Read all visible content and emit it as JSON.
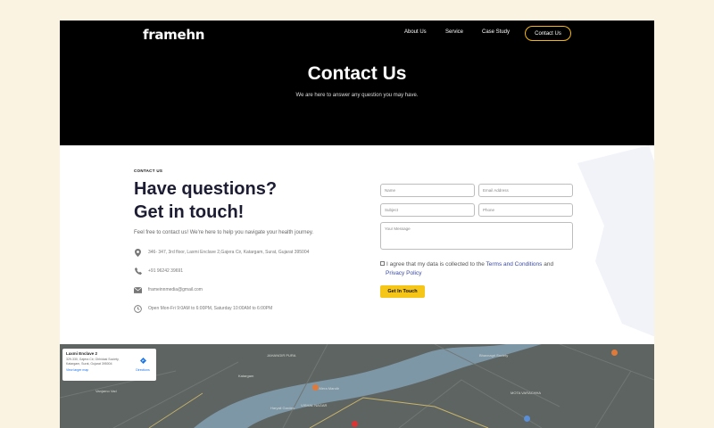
{
  "header": {
    "logo": "framehn",
    "nav": [
      "About Us",
      "Service",
      "Case Study"
    ],
    "cta": "Contact Us"
  },
  "hero": {
    "title": "Contact Us",
    "subtitle": "We are here to answer any question you may have."
  },
  "contact": {
    "eyebrow": "CONTACT US",
    "heading_line1": "Have questions?",
    "heading_line2": "Get in touch!",
    "intro": "Feel free to contact us! We're here to help you navigate your health journey.",
    "address": "346- 347, 3rd floor, Laxmi Enclave 2,Gajera Cir, Katargam, Surat, Gujarat 395004",
    "phone": "+91 96242 39691",
    "email": "frameinnmedia@gmail.com",
    "hours": "Open Mon-Fri 9:0AM to 6:00PM, Saturday 10:00AM to 6:00PM"
  },
  "form": {
    "name_placeholder": "Name",
    "email_placeholder": "Email Address",
    "subject_placeholder": "Subject",
    "phone_placeholder": "Phone",
    "message_placeholder": "Your Message",
    "consent_prefix": "I agree that my data is collected to the ",
    "terms_link": "Terms and Conditions",
    "consent_and": " and",
    "privacy_link": "Privacy Policy",
    "submit": "Get In Touch"
  },
  "map": {
    "card_title": "Laxmi Enclave 2",
    "card_address": "329-330, Gajera Cir, Ghhidasi Society, Katargam, Surat, Gujarat 395004",
    "card_link": "View larger map",
    "directions": "Directions",
    "labels": {
      "l1": "JAHANGIR PURA",
      "l2": "VISHAL NAGAR",
      "l3": "Vanjarno Vad",
      "l4": "Haryali Garden",
      "l5": "La Mera Mandir",
      "l6": "MOTA VARACHHA",
      "l7": "Bhavnagri Society",
      "l8": "Katargam"
    }
  },
  "colors": {
    "accent": "#f5c518",
    "heading": "#1c1c33",
    "link": "#3b4aa1"
  }
}
